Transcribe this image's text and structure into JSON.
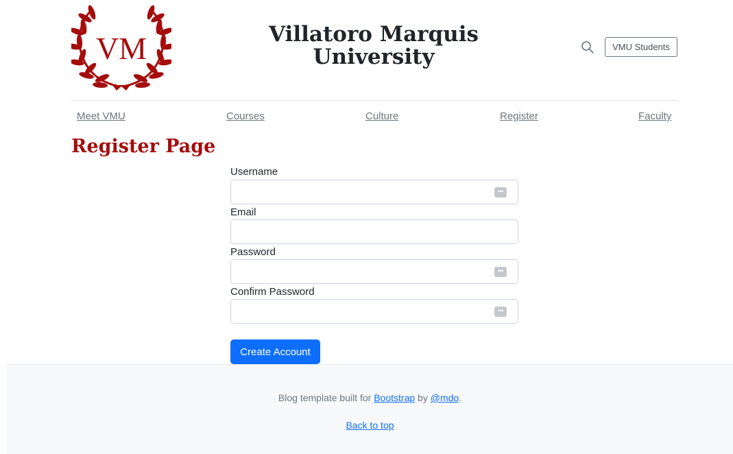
{
  "header": {
    "logo_text": "VM",
    "site_title_line1": "Villatoro Marquis",
    "site_title_line2": "University",
    "students_button": "VMU Students",
    "brand_color": "#a50d0d"
  },
  "nav": {
    "items": [
      {
        "label": "Meet VMU"
      },
      {
        "label": "Courses"
      },
      {
        "label": "Culture"
      },
      {
        "label": "Register"
      },
      {
        "label": "Faculty"
      }
    ]
  },
  "page": {
    "title": "Register Page"
  },
  "form": {
    "username_label": "Username",
    "email_label": "Email",
    "password_label": "Password",
    "confirm_label": "Confirm Password",
    "submit_label": "Create Account"
  },
  "footer": {
    "text_before": "Blog template built for ",
    "bootstrap_link": "Bootstrap",
    "text_middle": " by ",
    "mdo_link": "@mdo",
    "text_after": ".",
    "back_to_top": "Back to top"
  }
}
